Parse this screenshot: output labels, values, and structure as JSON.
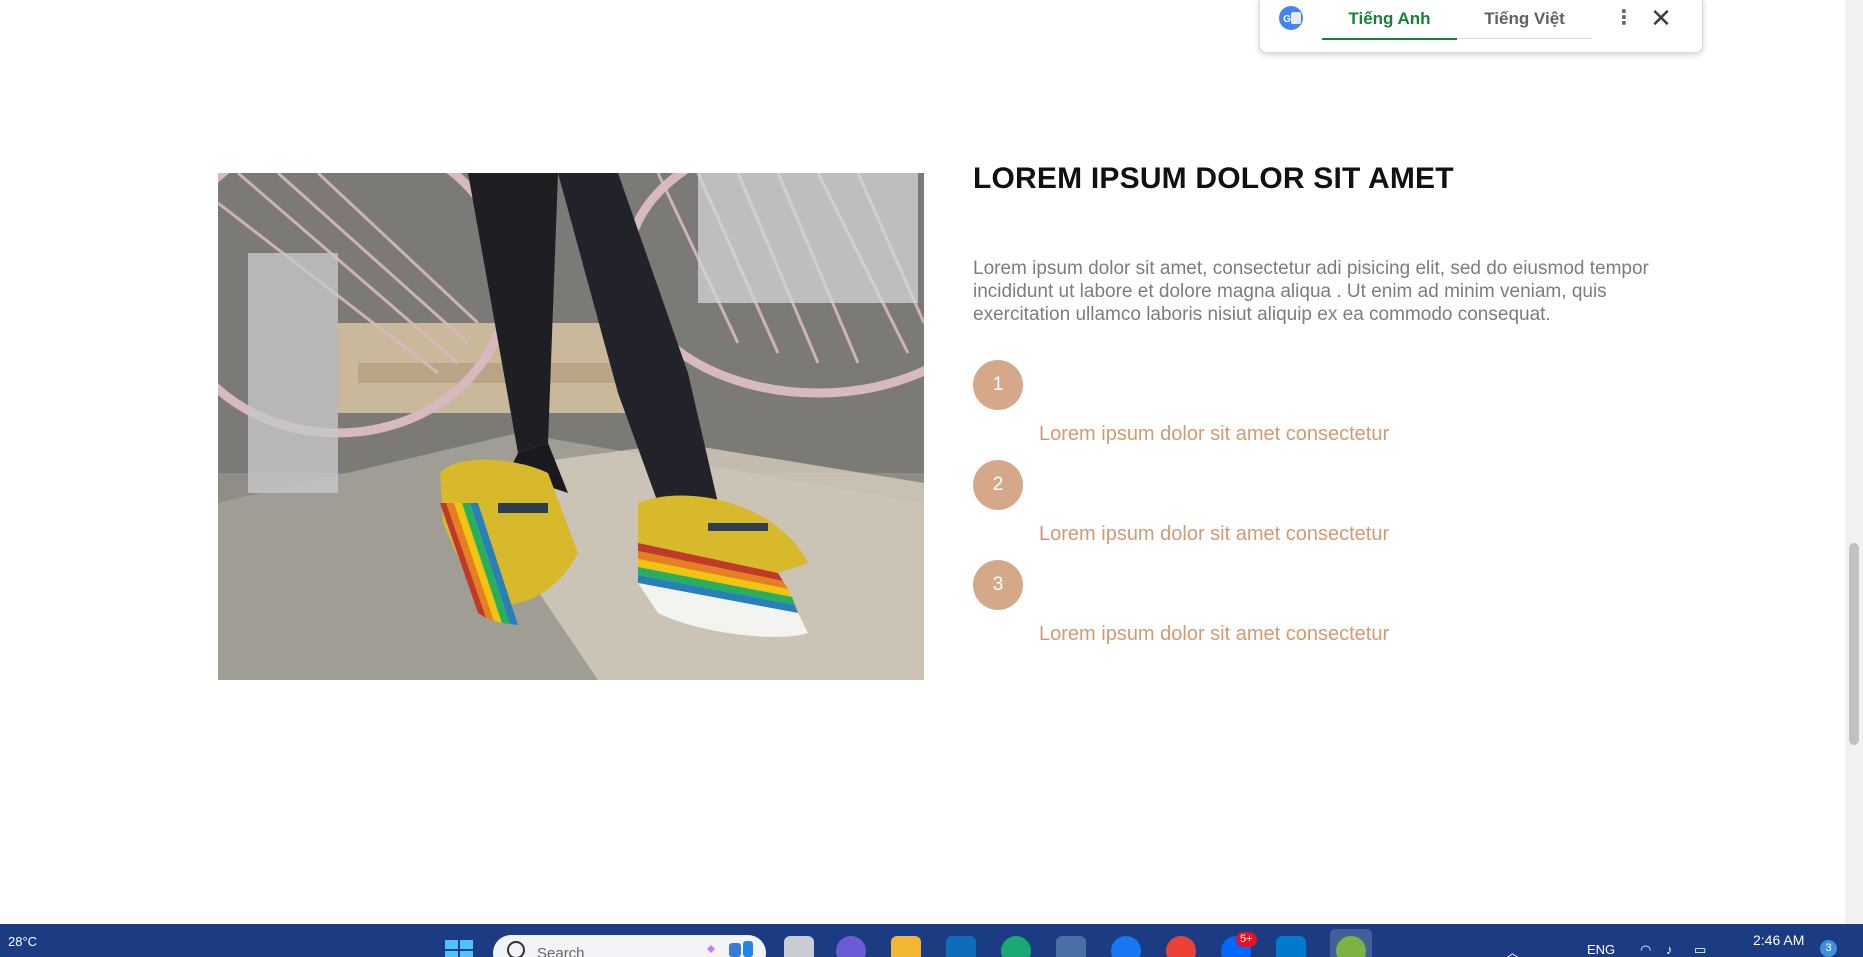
{
  "translate_bar": {
    "tabs": [
      "Tiếng Anh",
      "Tiếng Việt"
    ],
    "active_tab": "Tiếng Anh",
    "more_icon": "⋮",
    "close_icon": "✕"
  },
  "section": {
    "title": "LOREM IPSUM DOLOR SIT AMET",
    "description": "Lorem ipsum dolor sit amet, consectetur adi pisicing elit, sed do eiusmod tempor incididunt ut labore et dolore magna aliqua . Ut enim ad minim veniam, quis exercitation ullamco laboris nisiut aliquip ex ea commodo consequat.",
    "steps": [
      {
        "number": "1",
        "text": "Lorem ipsum dolor sit amet consectetur"
      },
      {
        "number": "2",
        "text": "Lorem ipsum dolor sit amet consectetur"
      },
      {
        "number": "3",
        "text": "Lorem ipsum dolor sit amet consectetur"
      }
    ],
    "accent_color": "#d6a88a"
  },
  "taskbar": {
    "weather": "28°C",
    "search_placeholder": "Search",
    "notification_badge": "5+",
    "language": "ENG",
    "time": "2:46 AM",
    "notification_count": "3"
  }
}
